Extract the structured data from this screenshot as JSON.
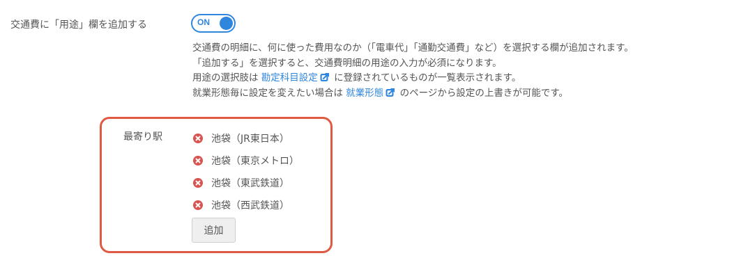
{
  "setting": {
    "label": "交通費に「用途」欄を追加する",
    "toggle_state": "ON"
  },
  "description": {
    "line1": "交通費の明細に、何に使った費用なのか（「電車代」「通勤交通費」など）を選択する欄が追加されます。",
    "line2": "「追加する」を選択すると、交通費明細の用途の入力が必須になります。",
    "line3_before": "用途の選択肢は ",
    "line3_link": "勘定科目設定",
    "line3_after": " に登録されているものが一覧表示されます。",
    "line4_before": "就業形態毎に設定を変えたい場合は ",
    "line4_link": "就業形態",
    "line4_after": " のページから設定の上書きが可能です。"
  },
  "stations": {
    "label": "最寄り駅",
    "items": [
      {
        "name": "池袋（JR東日本）"
      },
      {
        "name": "池袋（東京メトロ）"
      },
      {
        "name": "池袋（東武鉄道）"
      },
      {
        "name": "池袋（西武鉄道）"
      }
    ],
    "add_label": "追加"
  },
  "colors": {
    "accent": "#2e86de",
    "highlight_border": "#e05a43",
    "remove_icon": "#d9534f"
  },
  "icons": {
    "external_link": "external-link-icon",
    "remove": "remove-circle-icon"
  }
}
